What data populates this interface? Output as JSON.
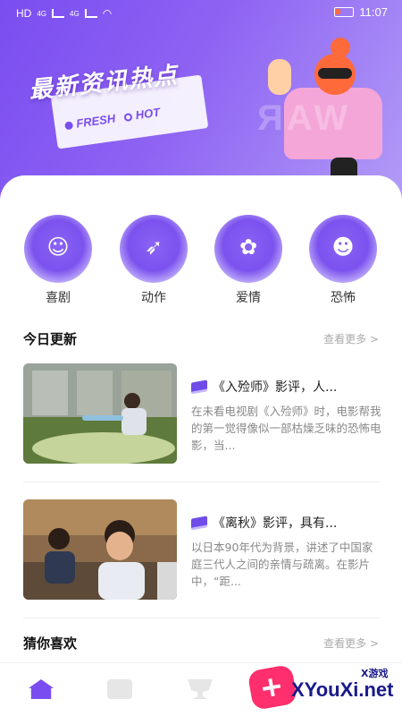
{
  "status_bar": {
    "network_left": "HD",
    "network_4g_1": "4G",
    "network_4g_2": "4G",
    "time": "11:07"
  },
  "hero": {
    "title": "最新资讯热点",
    "tag_fresh": "FRESH",
    "tag_hot": "HOT",
    "ghost_text": "ЯAW"
  },
  "categories": [
    {
      "label": "喜剧",
      "icon": "smile-face-icon",
      "glyph": "☺"
    },
    {
      "label": "动作",
      "icon": "running-figure-icon",
      "glyph": "➶"
    },
    {
      "label": "爱情",
      "icon": "heart-flower-icon",
      "glyph": "✿"
    },
    {
      "label": "恐怖",
      "icon": "devil-face-icon",
      "glyph": "☻"
    }
  ],
  "today_section": {
    "title": "今日更新",
    "more": "查看更多 >"
  },
  "articles": [
    {
      "title": "《入殓师》影评，人...",
      "desc": "在未看电视剧《入殓师》时，电影帮我的第一觉得像似一部枯燥乏味的恐怖电影，当..."
    },
    {
      "title": "《离秋》影评，具有...",
      "desc": "以日本90年代为背景，讲述了中国家庭三代人之间的亲情与疏离。在影片中，“距..."
    }
  ],
  "guess_section": {
    "title": "猜你喜欢",
    "more": "查看更多 >"
  },
  "tabbar": {
    "tabs": [
      "home-icon",
      "document-icon",
      "trophy-icon",
      "profile-icon"
    ]
  },
  "watermark": {
    "brand": "XYouXi.net",
    "sub": "X游戏"
  },
  "colors": {
    "accent": "#7a4df0",
    "muted": "#888888"
  }
}
